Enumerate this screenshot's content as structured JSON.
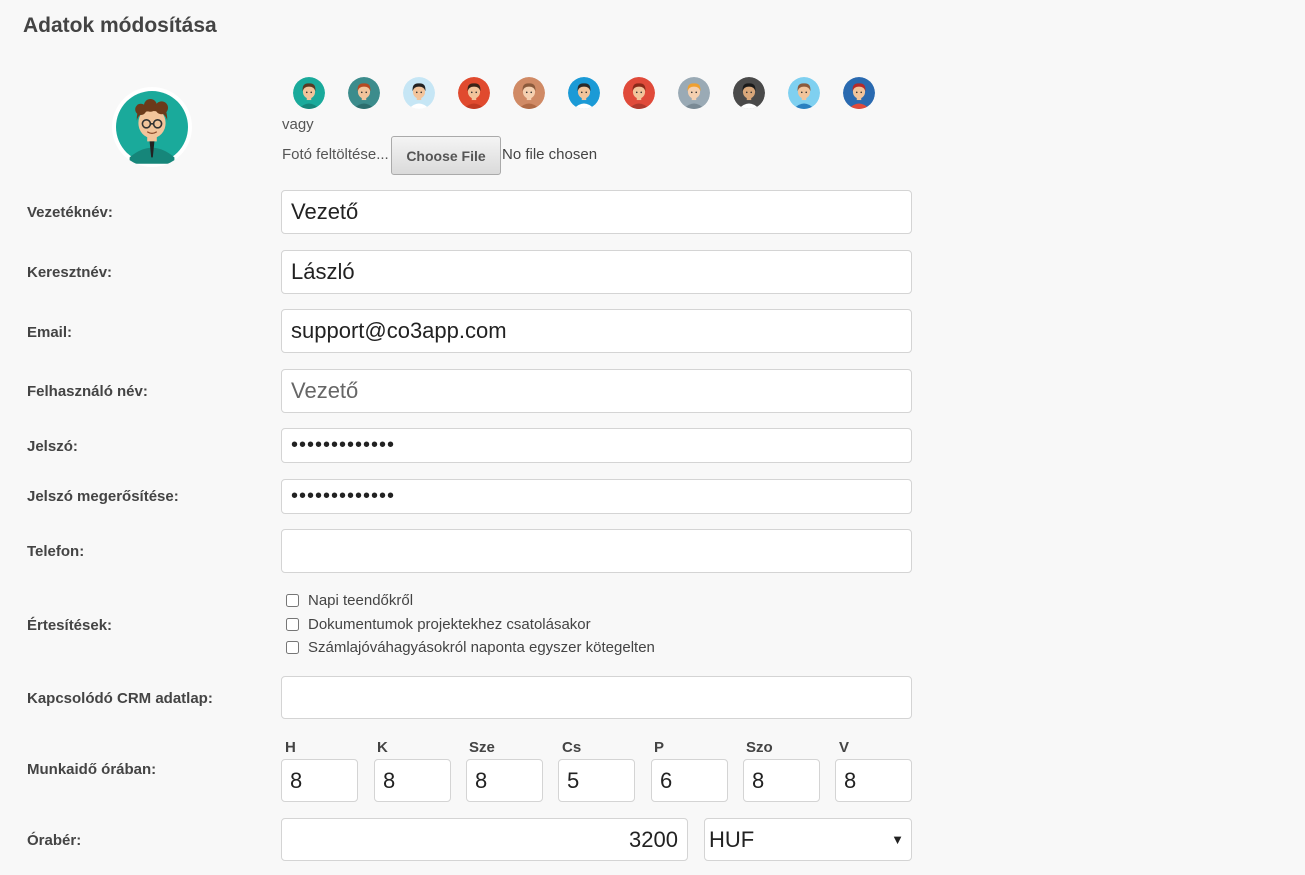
{
  "page_title": "Adatok módosítása",
  "avatar_picker": {
    "avatars": [
      {
        "name": "avatar-1",
        "bg": "#1aaa9b",
        "skin": "#f2c49b",
        "hair": "#5a3a22",
        "shirt": "#16867a"
      },
      {
        "name": "avatar-2",
        "bg": "#3c8c8c",
        "skin": "#f2c49b",
        "hair": "#b54a23",
        "shirt": "#2c6e6e"
      },
      {
        "name": "avatar-3",
        "bg": "#c6e6f5",
        "skin": "#f2c49b",
        "hair": "#222222",
        "shirt": "#ffffff"
      },
      {
        "name": "avatar-4",
        "bg": "#e04a2e",
        "skin": "#f2c49b",
        "hair": "#3a2418",
        "shirt": "#c23a22"
      },
      {
        "name": "avatar-5",
        "bg": "#d08a65",
        "skin": "#f5d0b0",
        "hair": "#8b5a3c",
        "shirt": "#b06a45"
      },
      {
        "name": "avatar-6",
        "bg": "#1b9ad6",
        "skin": "#f2c49b",
        "hair": "#2a2a2a",
        "shirt": "#ffffff"
      },
      {
        "name": "avatar-7",
        "bg": "#e04a3a",
        "skin": "#f2c49b",
        "hair": "#8a2a1a",
        "shirt": "#b03a2e"
      },
      {
        "name": "avatar-8",
        "bg": "#9aaab5",
        "skin": "#f5d0b0",
        "hair": "#f0a030",
        "shirt": "#7a8a95"
      },
      {
        "name": "avatar-9",
        "bg": "#4a4a4a",
        "skin": "#d9a77a",
        "hair": "#1a1a1a",
        "shirt": "#ffffff"
      },
      {
        "name": "avatar-10",
        "bg": "#7fd0f0",
        "skin": "#f2c49b",
        "hair": "#8b5a3c",
        "shirt": "#2a80c0"
      },
      {
        "name": "avatar-11",
        "bg": "#2a6ab0",
        "skin": "#f2c49b",
        "hair": "#b52a2a",
        "shirt": "#e04a3a"
      }
    ],
    "or_text": "vagy",
    "upload_label": "Fotó feltöltése...",
    "choose_file_label": "Choose File",
    "file_status": "No file chosen"
  },
  "fields": {
    "lastname": {
      "label": "Vezetéknév:",
      "value": "Vezető"
    },
    "firstname": {
      "label": "Keresztnév:",
      "value": "László"
    },
    "email": {
      "label": "Email:",
      "value": "support@co3app.com"
    },
    "username": {
      "label": "Felhasználó név:",
      "placeholder": "Vezető"
    },
    "password": {
      "label": "Jelszó:",
      "value": "•••••••••••••"
    },
    "password_confirm": {
      "label": "Jelszó megerősítése:",
      "value": "•••••••••••••"
    },
    "phone": {
      "label": "Telefon:",
      "value": ""
    },
    "crm": {
      "label": "Kapcsolódó CRM adatlap:",
      "value": ""
    }
  },
  "notifications": {
    "label": "Értesítések:",
    "options": [
      {
        "label": "Napi teendőkről",
        "checked": false
      },
      {
        "label": "Dokumentumok projektekhez csatolásakor",
        "checked": false
      },
      {
        "label": "Számlajóváhagyásokról naponta egyszer kötegelten",
        "checked": false
      }
    ]
  },
  "work_hours": {
    "label": "Munkaidő órában:",
    "days": [
      {
        "label": "H",
        "value": "8"
      },
      {
        "label": "K",
        "value": "8"
      },
      {
        "label": "Sze",
        "value": "8"
      },
      {
        "label": "Cs",
        "value": "5"
      },
      {
        "label": "P",
        "value": "6"
      },
      {
        "label": "Szo",
        "value": "8"
      },
      {
        "label": "V",
        "value": "8"
      }
    ]
  },
  "hourly_wage": {
    "label": "Órabér:",
    "value": "3200",
    "currency": "HUF"
  },
  "main_avatar": {
    "bg": "#1aaa9b",
    "skin": "#f2c49b",
    "hair": "#6b3a1a",
    "shirt": "#16867a"
  }
}
